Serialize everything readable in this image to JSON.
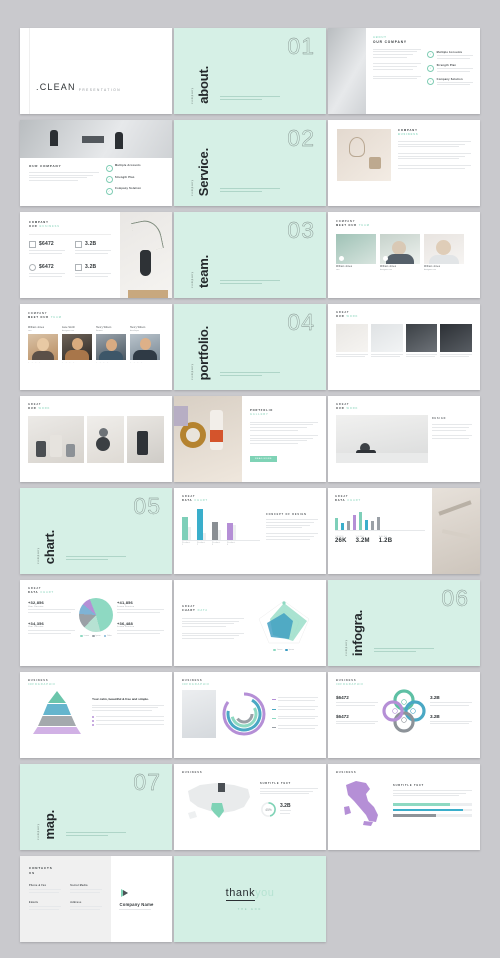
{
  "meta": {
    "background_color": "#c9c9cd",
    "accent_mint": "#7fd3b6",
    "slide_bg": "#ffffff",
    "divider_bg": "#d6f0e6"
  },
  "cover": {
    "brand": ".CLEAN",
    "subtitle": "PRESENTATION"
  },
  "dividers": [
    {
      "number": "01",
      "label": "company",
      "word": "about.",
      "blurb": "Lorem ipsum dolor sit amet consectetur adipiscing elit sed do"
    },
    {
      "number": "02",
      "label": "company",
      "word": "Service.",
      "blurb": "Lorem ipsum dolor sit amet consectetur adipiscing elit sed do"
    },
    {
      "number": "03",
      "label": "company",
      "word": "team.",
      "blurb": "Lorem ipsum dolor sit amet consectetur adipiscing elit sed do"
    },
    {
      "number": "04",
      "label": "company",
      "word": "portfolio.",
      "blurb": "Lorem ipsum dolor sit amet consectetur adipiscing elit sed do"
    },
    {
      "number": "05",
      "label": "company",
      "word": "chart.",
      "blurb": "Lorem ipsum dolor sit amet consectetur adipiscing elit sed do"
    },
    {
      "number": "06",
      "label": "company",
      "word": "infogra.",
      "blurb": "Lorem ipsum dolor sit amet consectetur adipiscing elit sed do"
    },
    {
      "number": "07",
      "label": "company",
      "word": "map.",
      "blurb": "Lorem ipsum dolor sit amet consectetur adipiscing elit sed do"
    }
  ],
  "about_slide": {
    "eyebrow_small": "ABOUT",
    "title": "OUR COMPANY",
    "body": "Lorem ipsum dolor sit amet, consectetur adipiscing elit, sed do eiusmod tempor incididunt ut labore et dolore magna aliqua.",
    "checklist": [
      {
        "title": "Multiple Accounts",
        "desc": "Lorem ipsum dolor sit amet consectetur"
      },
      {
        "title": "Strength Plan",
        "desc": "Lorem ipsum dolor sit amet consectetur"
      },
      {
        "title": "Company Solution",
        "desc": "Lorem ipsum dolor sit amet consectetur"
      }
    ]
  },
  "service_slide": {
    "title": "OUR COMPANY",
    "body": "Lorem ipsum dolor sit amet, consectetur adipiscing elit, sed do eiusmod tempor incididunt ut labore.",
    "checklist": [
      {
        "title": "Multiple Accounts"
      },
      {
        "title": "Strength Plan"
      },
      {
        "title": "Company Solution"
      }
    ]
  },
  "stats_slide": {
    "eyebrow": "COMPANY",
    "subtitle": "OUR",
    "subtitle_accent": "BUSINESS",
    "items": [
      {
        "icon": "chart-icon",
        "value": "$6472",
        "caption": "Lorem ipsum dolor"
      },
      {
        "icon": "card-icon",
        "value": "3.2B",
        "caption": "Lorem ipsum dolor"
      },
      {
        "icon": "coin-icon",
        "value": "$6472",
        "caption": "Lorem ipsum dolor"
      },
      {
        "icon": "bar-icon",
        "value": "3.2B",
        "caption": "Lorem ipsum dolor"
      }
    ]
  },
  "team_slide_3": {
    "eyebrow": "COMPANY",
    "title": "MEET OUR",
    "title_accent": "TEAM",
    "members": [
      {
        "name": "William Jones",
        "role": "ceo"
      },
      {
        "name": "William Jones",
        "role": "designer ceo"
      },
      {
        "name": "William Jones",
        "role": "designer ceo"
      }
    ]
  },
  "team_slide_4": {
    "eyebrow": "COMPANY",
    "title": "MEET OUR",
    "title_accent": "TEAM",
    "members": [
      {
        "name": "William Jones",
        "role": "ceo",
        "dots": "• • • •"
      },
      {
        "name": "Jane Smith",
        "role": "designer ceo",
        "dots": "• • • •"
      },
      {
        "name": "Henry Wilson",
        "role": "finance",
        "dots": "• • • •"
      },
      {
        "name": "Henry Wilson",
        "role": "developer",
        "dots": "• • • •"
      }
    ]
  },
  "portfolio_grid": {
    "eyebrow": "GREAT",
    "title": "OUR",
    "title_accent": "WORK"
  },
  "portfolio_detail": {
    "title": "PORTFOLIO",
    "subtitle": "GALLERY",
    "body": "Lorem ipsum dolor sit amet, consectetur adipiscing elit, sed do eiusmod tempor incididunt ut labore.",
    "button": "READ MORE"
  },
  "great_our": {
    "eyebrow": "GREAT",
    "title": "OUR",
    "title_accent": "WORK",
    "caption": "Design"
  },
  "chart_data": [
    {
      "id": "bar-chart-slide",
      "type": "bar",
      "title": "GREAT",
      "subtitle": "DATA",
      "subtitle_accent": "CHART",
      "categories": [
        "Product 1",
        "Product 2",
        "Product 3",
        "Product 4"
      ],
      "values": [
        68,
        92,
        55,
        52
      ],
      "ghost_values": [
        40,
        22,
        30,
        46
      ],
      "value_labels": [
        "68%",
        "92%",
        "55%",
        "52%"
      ],
      "colors": [
        "#7ecfb9",
        "#3aaecb",
        "#8a8f94",
        "#b58fd6"
      ],
      "ylim": [
        0,
        100
      ],
      "side_title": "Concept of Design",
      "side_body": "Lorem ipsum dolor sit amet, consectetur adipiscing elit, sed do eiusmod tempor."
    },
    {
      "id": "mini-bar-kpi-slide",
      "type": "bar",
      "title": "GREAT",
      "subtitle": "DATA",
      "subtitle_accent": "CHART",
      "categories": [
        "a",
        "b",
        "c",
        "d",
        "e",
        "f",
        "g",
        "h"
      ],
      "values": [
        52,
        30,
        42,
        66,
        80,
        46,
        40,
        58
      ],
      "colors": [
        "#7ecfb9",
        "#3aaecb",
        "#9aa0a6",
        "#b58fd6",
        "#7ecfb9",
        "#3aaecb",
        "#9aa0a6",
        "#9aa0a6"
      ],
      "ylim": [
        0,
        100
      ],
      "kpis": [
        {
          "label": "USERS",
          "value": "26K"
        },
        {
          "label": "VIEWS",
          "value": "3.2M"
        },
        {
          "label": "SALES",
          "value": "1.2B"
        }
      ]
    },
    {
      "id": "pie-chart-slide",
      "type": "pie",
      "title": "GREAT",
      "subtitle": "DATA",
      "subtitle_accent": "CHART",
      "slices": [
        {
          "label": "Lorem Ipsum",
          "value": 46,
          "color": "#8ed9c2"
        },
        {
          "label": "Lorem Ipsum",
          "value": 16,
          "color": "#b6e2d3"
        },
        {
          "label": "Lorem Ipsum",
          "value": 14,
          "color": "#9aa0a6"
        },
        {
          "label": "Lorem Ipsum",
          "value": 10,
          "color": "#7fb3d5"
        },
        {
          "label": "Lorem Ipsum",
          "value": 8,
          "color": "#b58fd6"
        }
      ],
      "stats": [
        {
          "value": "+32,856",
          "label": "User Session",
          "desc": "Lorem ipsum dolor sit amet consectetur adipiscing"
        },
        {
          "value": "+41,856",
          "label": "Lorem Session",
          "desc": "Lorem ipsum dolor sit amet consectetur adipiscing"
        },
        {
          "value": "+34,356",
          "label": "User Session",
          "desc": "Lorem ipsum dolor sit amet consectetur adipiscing"
        },
        {
          "value": "+36,488",
          "label": "Lorem Session",
          "desc": "Lorem ipsum dolor sit amet consectetur adipiscing"
        }
      ],
      "legend": [
        "Lorem",
        "Ipsum",
        "Dolor",
        "Amet"
      ]
    },
    {
      "id": "radar-chart-slide",
      "type": "radar",
      "title": "GREAT",
      "subtitle": "CHART",
      "subtitle_accent": "DATA",
      "body": "Lorem ipsum dolor sit amet, consectetur adipiscing elit, sed do eiusmod tempor incididunt ut labore.",
      "axes": [
        "Lorem",
        "Ipsum",
        "Dolor",
        "Sit",
        "Amet"
      ],
      "series": [
        {
          "name": "Series A",
          "color": "#8ed9c2",
          "values": [
            80,
            70,
            55,
            65,
            75
          ]
        },
        {
          "name": "Series B",
          "color": "#3a9bc1",
          "values": [
            50,
            45,
            70,
            40,
            35
          ]
        }
      ],
      "legend": [
        "Lorem",
        "Ipsum"
      ]
    },
    {
      "id": "pyramid-slide",
      "type": "pyramid",
      "title": "BUSINESS",
      "subtitle": "INFOGRAPHIC",
      "heading": "Your calm, beautiful & free and simple.",
      "body": "Lorem ipsum dolor sit amet, consectetur adipiscing elit, sed do eiusmod tempor incididunt.",
      "levels": [
        {
          "label": "Lorem",
          "color": "#5ec0a4"
        },
        {
          "label": "Ipsum",
          "color": "#4aa8c4"
        },
        {
          "label": "Dolor",
          "color": "#8d9399"
        },
        {
          "label": "Amet",
          "color": "#c9a3e0"
        }
      ],
      "bullets": [
        "Lorem ipsum dolor sit",
        "Consectetur adipiscing",
        "Sed do eiusmod tempor"
      ]
    },
    {
      "id": "spiral-slide",
      "type": "radial",
      "title": "BUSINESS",
      "subtitle": "INFOGRAPHIC",
      "rings": [
        {
          "label": "Lorem Ipsum",
          "value": 85,
          "color": "#b58fd6"
        },
        {
          "label": "Lorem Ipsum",
          "value": 70,
          "color": "#4aa8c4"
        },
        {
          "label": "Lorem Ipsum",
          "value": 55,
          "color": "#8ed9c2"
        },
        {
          "label": "Lorem Ipsum",
          "value": 40,
          "color": "#9aa0a6"
        }
      ]
    },
    {
      "id": "clover-slide",
      "type": "diagram",
      "title": "BUSINESS",
      "subtitle": "INFOGRAPHIC",
      "items": [
        {
          "value": "$6472",
          "desc": "Lorem ipsum dolor sit amet consectetur",
          "color": "#b58fd6"
        },
        {
          "value": "3.2B",
          "desc": "Lorem ipsum dolor sit amet consectetur",
          "color": "#4aa8c4"
        },
        {
          "value": "$6472",
          "desc": "Lorem ipsum dolor sit amet consectetur",
          "color": "#8ed9c2"
        },
        {
          "value": "3.2B",
          "desc": "Lorem ipsum dolor sit amet consectetur",
          "color": "#8d9399"
        }
      ]
    },
    {
      "id": "usa-map-slide",
      "type": "map",
      "title": "BUSINESS",
      "subtitle": "MAP",
      "heading": "Subtitle text",
      "body": "Lorem ipsum dolor sit amet consectetur adipiscing elit sed do eiusmod.",
      "donut": {
        "value": "3.2B",
        "percent": "45%",
        "caption": "Lorem ipsum dolor sit amet"
      },
      "highlighted": [
        "Texas",
        "Minnesota"
      ]
    },
    {
      "id": "italy-map-slide",
      "type": "map",
      "title": "BUSINESS",
      "subtitle": "MAP",
      "heading": "Subtitle text",
      "body": "Lorem ipsum dolor sit amet consectetur adipiscing elit sed do eiusmod tempor.",
      "bars": [
        {
          "label": "Lorem",
          "value": 72,
          "color": "#8ed9c2"
        },
        {
          "label": "Ipsum",
          "value": 88,
          "color": "#3aaecb"
        },
        {
          "label": "Dolor",
          "value": 55,
          "color": "#8d9399"
        }
      ],
      "country": "Italy",
      "country_color": "#b58fd6"
    }
  ],
  "contacts": {
    "title": "CONTACTS",
    "title2": "US",
    "blocks": [
      {
        "label": "Phone & Fax",
        "value": "+123 456 7890 / +123 456 7891"
      },
      {
        "label": "Social Media",
        "value": "@companyname"
      },
      {
        "label": "Emails",
        "value": "hello@company.com\\nsupport@company.com"
      },
      {
        "label": "Address",
        "value": "Lorem ipsum street\\nNew York, USA"
      }
    ],
    "company_name": "Company Name",
    "company_tag": "Lorem ipsum dolor sit"
  },
  "thankyou": {
    "word_dark": "thank",
    "word_light": "you",
    "tagline": "THE END"
  }
}
